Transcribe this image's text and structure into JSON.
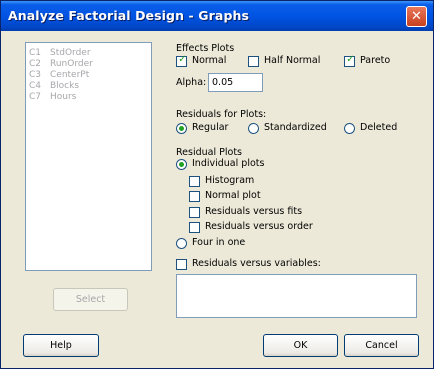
{
  "window": {
    "title": "Analyze Factorial Design - Graphs"
  },
  "variables": [
    {
      "col": "C1",
      "name": "StdOrder"
    },
    {
      "col": "C2",
      "name": "RunOrder"
    },
    {
      "col": "C3",
      "name": "CenterPt"
    },
    {
      "col": "C4",
      "name": "Blocks"
    },
    {
      "col": "C7",
      "name": "Hours"
    }
  ],
  "select_button": "Select",
  "effects_plots": {
    "heading": "Effects Plots",
    "normal": {
      "label": "Normal",
      "checked": true
    },
    "half_normal": {
      "label": "Half Normal",
      "checked": false
    },
    "pareto": {
      "label": "Pareto",
      "checked": true
    },
    "alpha_label": "Alpha:",
    "alpha_value": "0.05"
  },
  "residuals_for_plots": {
    "heading": "Residuals for Plots:",
    "regular": "Regular",
    "standardized": "Standardized",
    "deleted": "Deleted",
    "selected": "regular"
  },
  "residual_plots": {
    "heading": "Residual Plots",
    "individual": "Individual plots",
    "histogram": "Histogram",
    "normal_plot": "Normal plot",
    "vs_fits": "Residuals versus fits",
    "vs_order": "Residuals versus order",
    "four_in_one": "Four in one",
    "selected": "individual"
  },
  "residuals_vs_variables": "Residuals versus variables:",
  "buttons": {
    "help": "Help",
    "ok": "OK",
    "cancel": "Cancel"
  }
}
